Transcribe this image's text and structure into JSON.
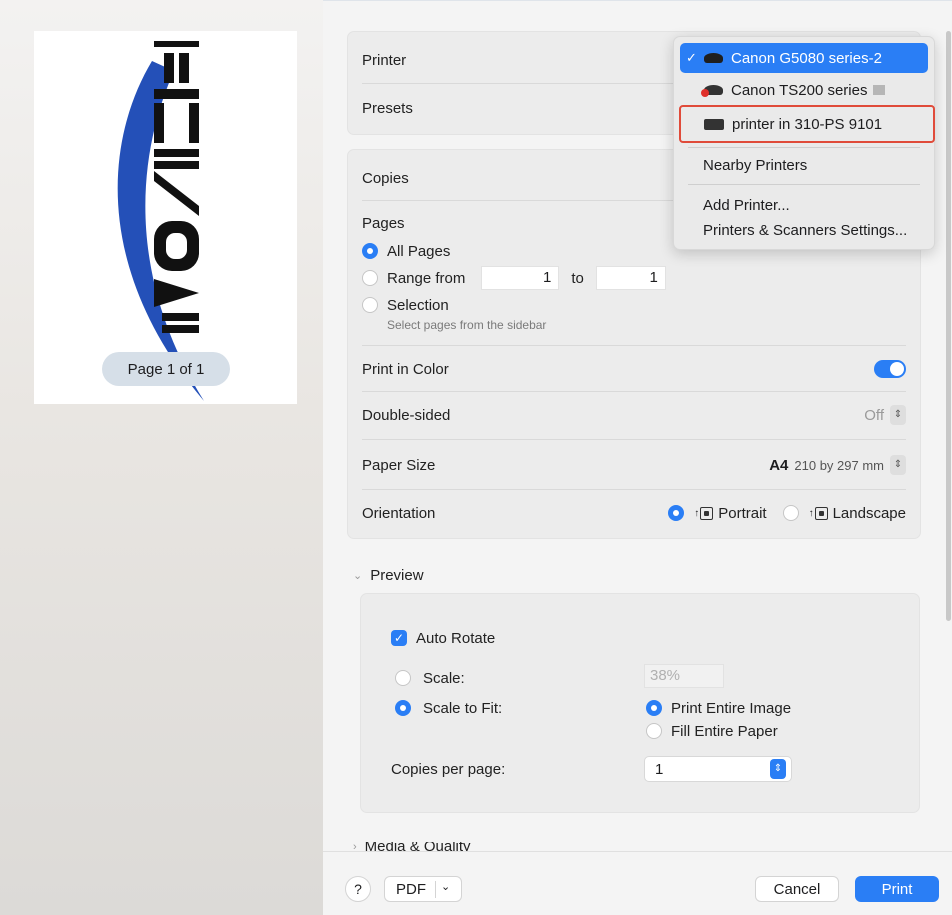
{
  "preview": {
    "page_indicator": "Page 1 of 1"
  },
  "printer_card": {
    "printer_label": "Printer",
    "presets_label": "Presets"
  },
  "printer_menu": {
    "items": [
      {
        "check": "✓",
        "label": "Canon G5080 series-2"
      },
      {
        "label": "Canon TS200 series"
      },
      {
        "label": "printer in 310-PS 9101"
      }
    ],
    "nearby": "Nearby Printers",
    "add_printer": "Add Printer...",
    "settings": "Printers & Scanners Settings..."
  },
  "copies_card": {
    "copies_label": "Copies",
    "pages_label": "Pages",
    "all_pages": "All Pages",
    "range_from": "Range from",
    "range_from_value": "1",
    "range_to": "to",
    "range_to_value": "1",
    "selection": "Selection",
    "selection_hint": "Select pages from the sidebar",
    "print_in_color": "Print in Color",
    "double_sided": "Double-sided",
    "double_sided_value": "Off",
    "paper_size": "Paper Size",
    "paper_size_value": "A4",
    "paper_size_dims": "210 by 297 mm",
    "orientation": "Orientation",
    "portrait": "Portrait",
    "landscape": "Landscape"
  },
  "preview_section": {
    "header": "Preview",
    "auto_rotate": "Auto Rotate",
    "scale": "Scale:",
    "scale_value": "38%",
    "scale_to_fit": "Scale to Fit:",
    "print_entire_image": "Print Entire Image",
    "fill_entire_paper": "Fill Entire Paper",
    "copies_per_page": "Copies per page:",
    "copies_per_page_value": "1"
  },
  "media_section": {
    "header": "Media & Quality"
  },
  "bottom_bar": {
    "help": "?",
    "pdf": "PDF",
    "cancel": "Cancel",
    "print": "Print"
  },
  "colors": {
    "accent": "#2a7ef5",
    "highlight_box": "#e04b3a"
  }
}
